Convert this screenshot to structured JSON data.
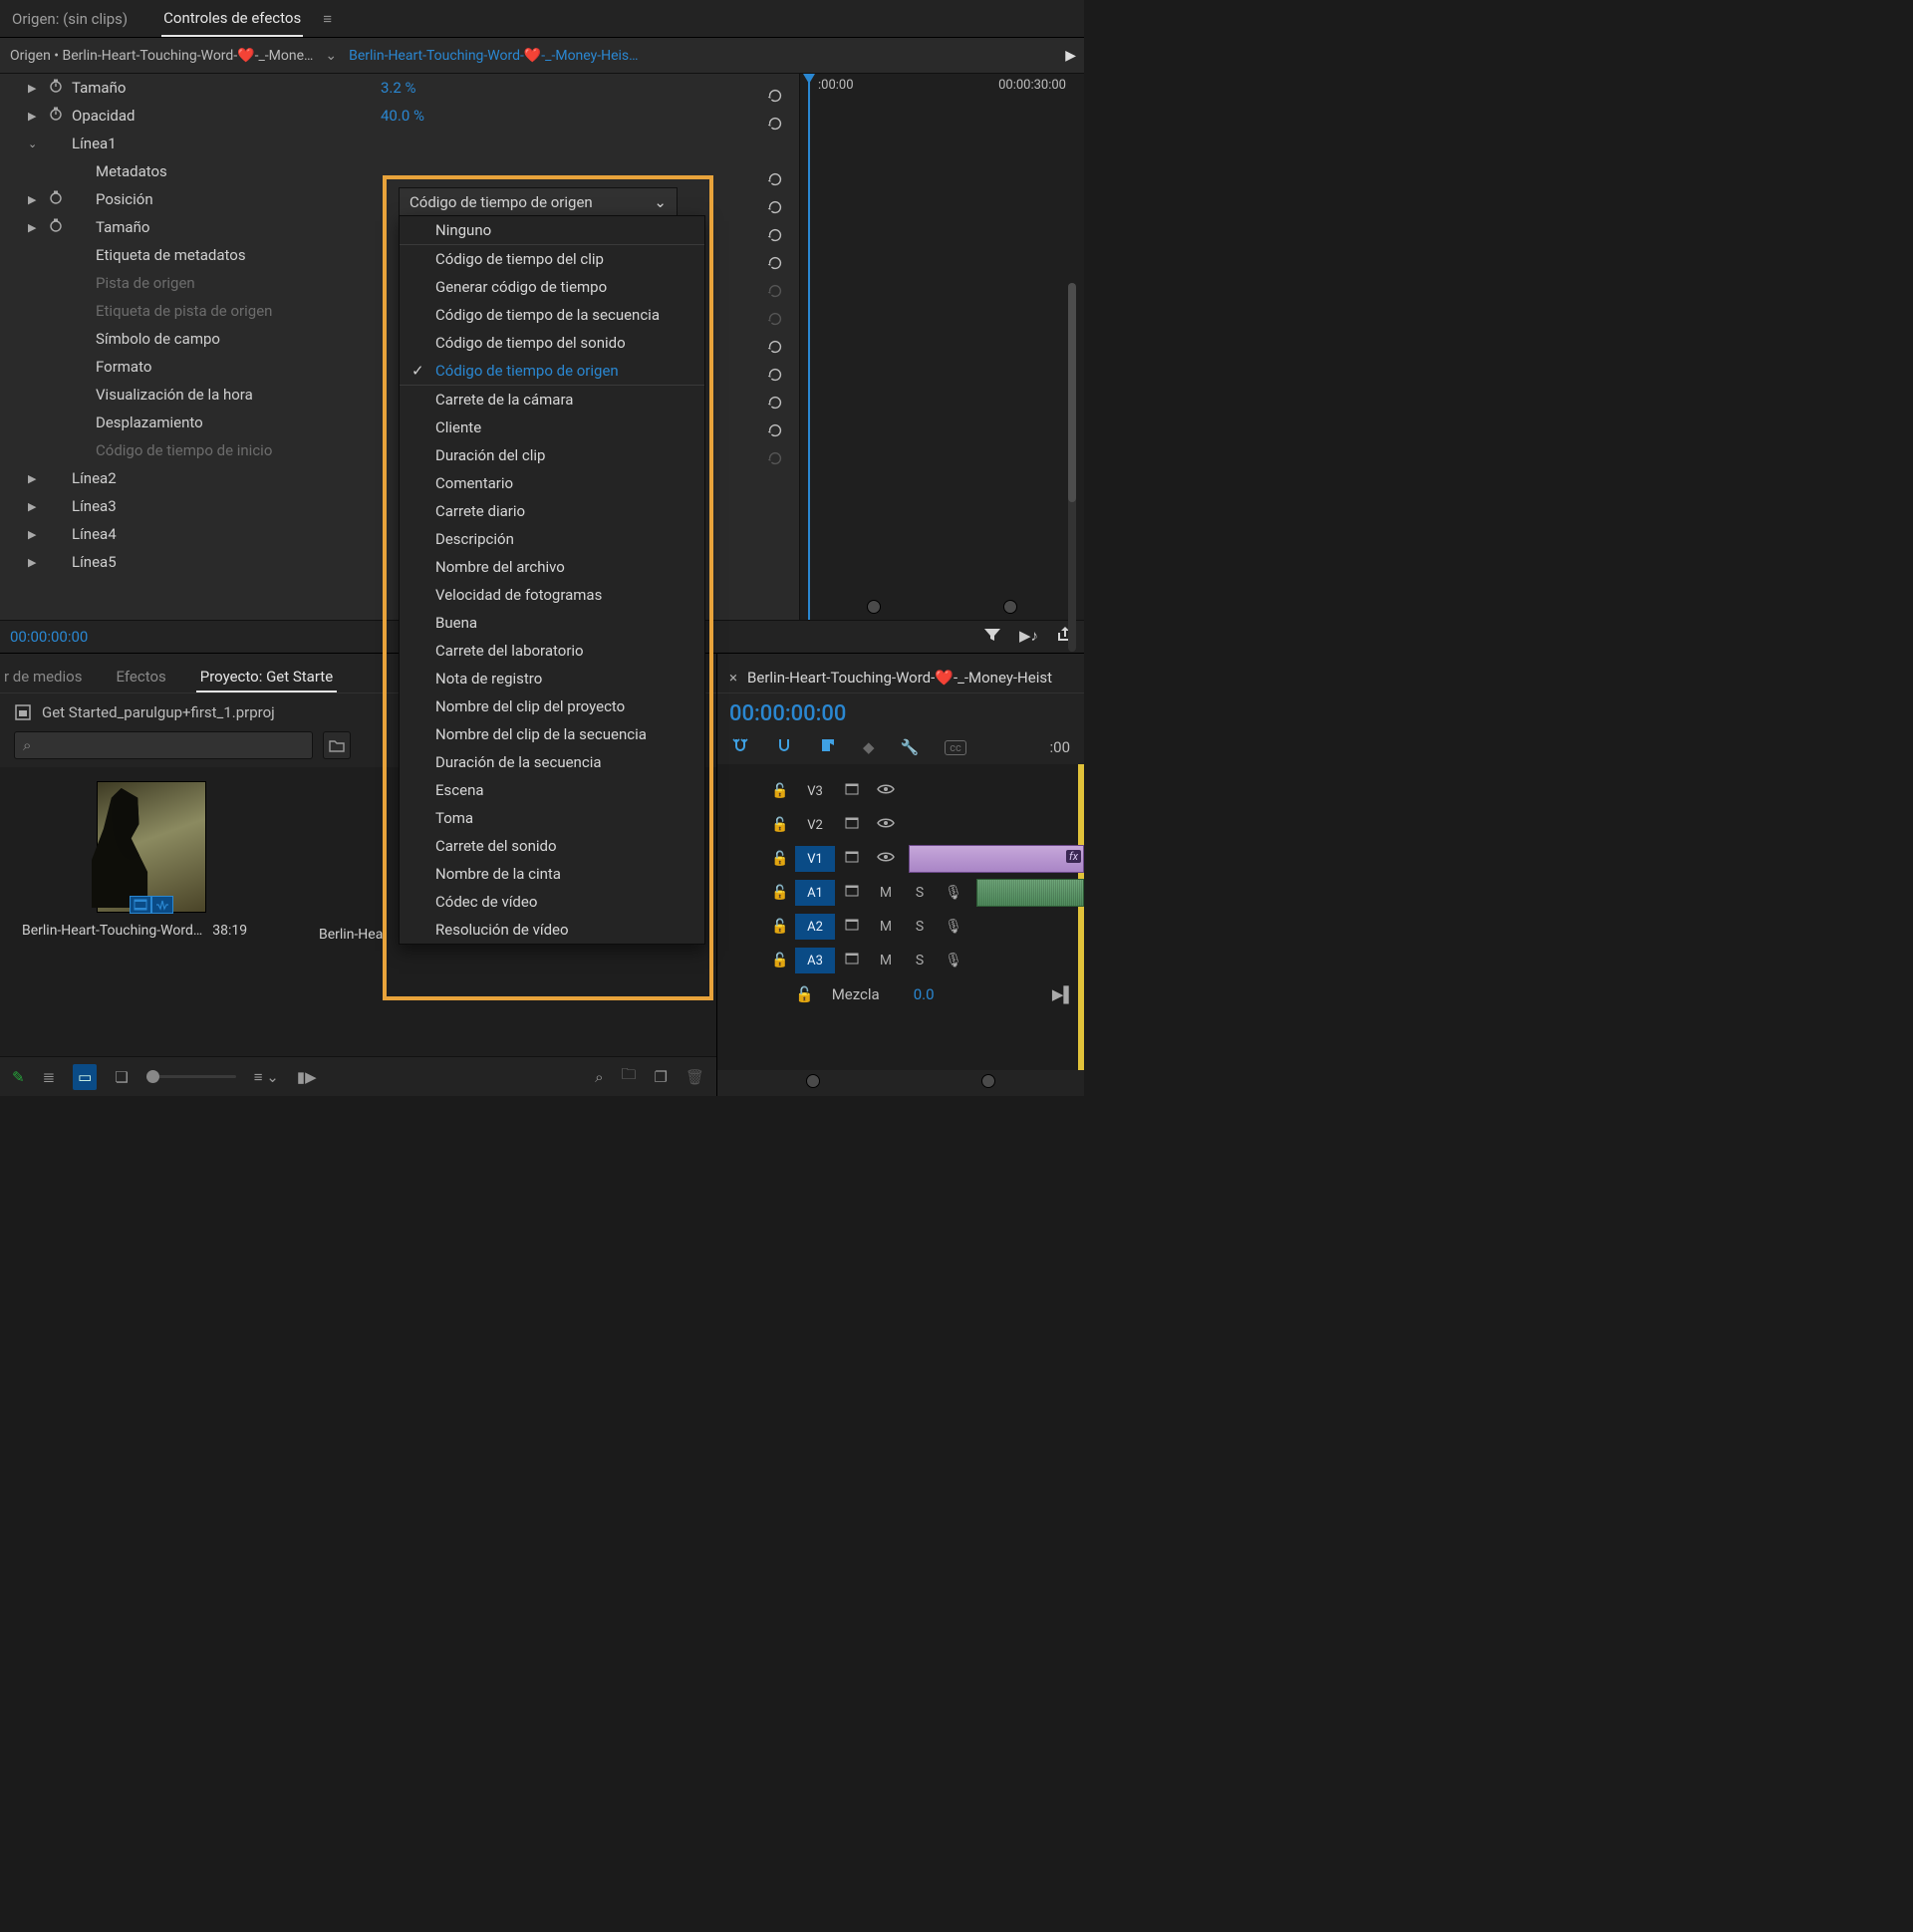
{
  "topTabs": {
    "origin": "Origen: (sin clips)",
    "effects": "Controles de efectos"
  },
  "sourceRow": {
    "origin": "Origen • Berlin-Heart-Touching-Word-❤️-_-Mone…",
    "clip": "Berlin-Heart-Touching-Word-❤️-_-Money-Heis…"
  },
  "params": {
    "tamano": {
      "label": "Tamaño",
      "value": "3.2 %"
    },
    "opacidad": {
      "label": "Opacidad",
      "value": "40.0 %"
    },
    "linea1": "Línea1",
    "metadatos": "Metadatos",
    "posicion": "Posición",
    "tamano2": "Tamaño",
    "etiqueta": "Etiqueta de metadatos",
    "pistaOrigen": "Pista de origen",
    "etiquetaPista": "Etiqueta de pista de origen",
    "simbolo": "Símbolo de campo",
    "formato": "Formato",
    "visHora": "Visualización de la hora",
    "desplaz": "Desplazamiento",
    "codInicio": "Código de tiempo de inicio",
    "linea2": "Línea2",
    "linea3": "Línea3",
    "linea4": "Línea4",
    "linea5": "Línea5"
  },
  "dropdown": {
    "selected": "Código de tiempo de origen",
    "items": [
      "Ninguno",
      "Código de tiempo del clip",
      "Generar código de tiempo",
      "Código de tiempo de la secuencia",
      "Código de tiempo del sonido",
      "Código de tiempo de origen",
      "Carrete de la cámara",
      "Cliente",
      "Duración del clip",
      "Comentario",
      "Carrete diario",
      "Descripción",
      "Nombre del archivo",
      "Velocidad de fotogramas",
      "Buena",
      "Carrete del laboratorio",
      "Nota de registro",
      "Nombre del clip del proyecto",
      "Nombre del clip de la secuencia",
      "Duración de la secuencia",
      "Escena",
      "Toma",
      "Carrete del sonido",
      "Nombre de la cinta",
      "Códec de vídeo",
      "Resolución de vídeo"
    ]
  },
  "timeline": {
    "t0": ":00:00",
    "t1": "00:00:30:00",
    "currentTC": "00:00:00:00"
  },
  "projTabs": {
    "media": "r de medios",
    "efectos": "Efectos",
    "proyecto": "Proyecto: Get Starte"
  },
  "proj": {
    "file": "Get Started_parulgup+first_1.prproj",
    "clip1Name": "Berlin-Heart-Touching-Word…",
    "clip1Dur": "38:19",
    "clip2Name": "Berlin-Hea"
  },
  "seq": {
    "tab": "Berlin-Heart-Touching-Word-❤️-_-Money-Heist",
    "tc": "00:00:00:00",
    "tlStart": ":00",
    "mezcla": "Mezcla",
    "mezclaVal": "0.0",
    "tracks": {
      "v3": "V3",
      "v2": "V2",
      "v1": "V1",
      "a1": "A1",
      "a2": "A2",
      "a3": "A3",
      "m": "M",
      "s": "S",
      "fx": "fx"
    }
  }
}
